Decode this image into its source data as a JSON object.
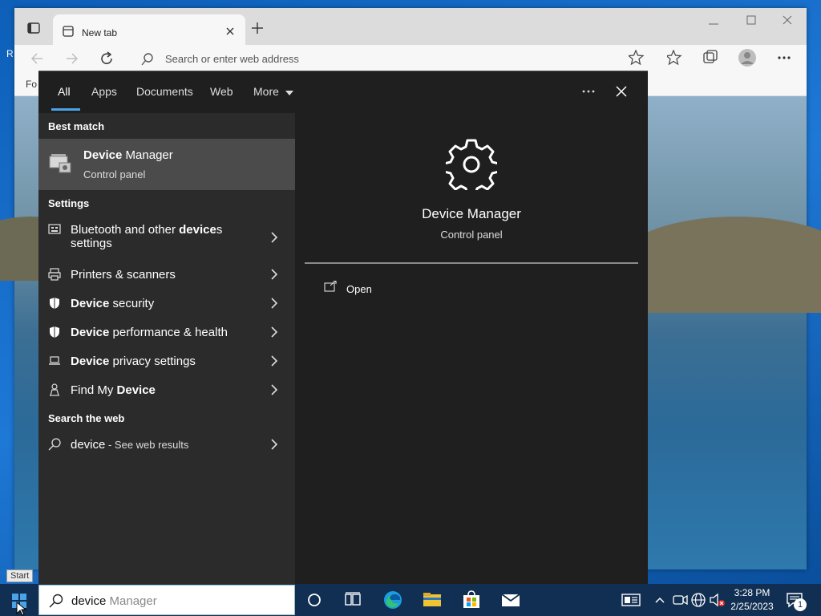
{
  "browser": {
    "tab_title": "New tab",
    "address_placeholder": "Search or enter web address",
    "favorites_bar_partial": "Fo"
  },
  "search_tabs": [
    {
      "label": "All",
      "active": true
    },
    {
      "label": "Apps"
    },
    {
      "label": "Documents"
    },
    {
      "label": "Web"
    },
    {
      "label": "More"
    }
  ],
  "best_match": {
    "heading": "Best match",
    "title_bold": "Device",
    "title_rest": " Manager",
    "subtitle": "Control panel"
  },
  "settings": {
    "heading": "Settings",
    "items": [
      {
        "pre": "Bluetooth and other ",
        "bold": "device",
        "post": "s",
        "line2": "settings",
        "icon": "bluetooth-devices-icon"
      },
      {
        "pre": "Printers & scanners",
        "bold": "",
        "post": "",
        "icon": "printer-icon"
      },
      {
        "pre": "",
        "bold": "Device",
        "post": " security",
        "icon": "shield-icon"
      },
      {
        "pre": "",
        "bold": "Device",
        "post": " performance & health",
        "icon": "shield-icon"
      },
      {
        "pre": "",
        "bold": "Device",
        "post": " privacy settings",
        "icon": "laptop-icon"
      },
      {
        "pre": "Find My ",
        "bold": "Device",
        "post": "",
        "icon": "person-pin-icon"
      }
    ]
  },
  "web": {
    "heading": "Search the web",
    "query": "device",
    "suffix": " - See web results"
  },
  "preview": {
    "title": "Device Manager",
    "subtitle": "Control panel",
    "action": "Open"
  },
  "taskbar": {
    "search_typed": "device",
    "search_autocomplete": " Manager",
    "start_tooltip": "Start",
    "time": "3:28 PM",
    "date": "2/25/2023",
    "notification_count": "1"
  },
  "colors": {
    "flyout_bg": "#1f1f1f",
    "left_pane_bg": "#2b2b2b",
    "highlight_bg": "#4b4b4b",
    "accent": "#4aa3e6",
    "taskbar_bg": "#112f52"
  }
}
